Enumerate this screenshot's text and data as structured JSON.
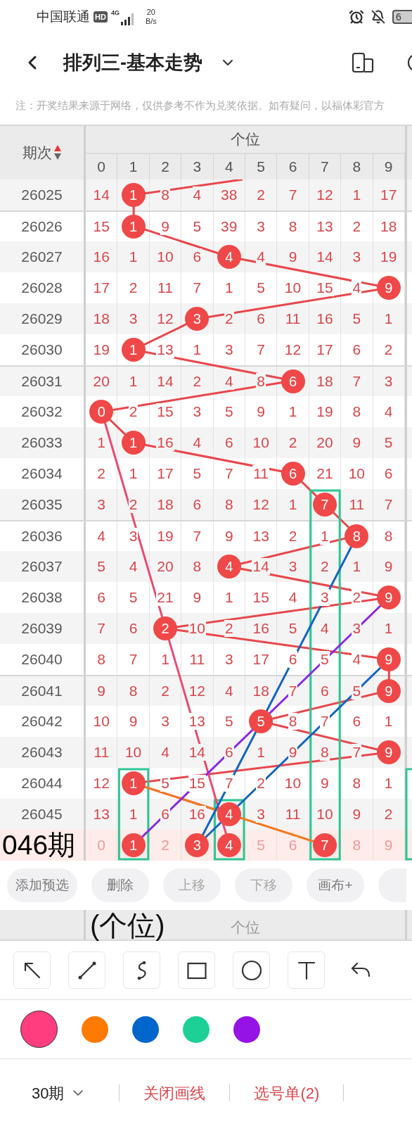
{
  "status_bar": {
    "carrier": "中国联通",
    "hd": "HD",
    "network": "4G",
    "speed_value": "20",
    "speed_unit": "B/s",
    "battery": "6"
  },
  "title_bar": {
    "title": "排列三-基本走势"
  },
  "notice": "注：开奖结果来源于网络，仅供参考不作为兑奖依据。如有疑问，以福体彩官方",
  "table": {
    "period_header": "期次",
    "group_header": "个位",
    "columns": [
      "0",
      "1",
      "2",
      "3",
      "4",
      "5",
      "6",
      "7",
      "8",
      "9"
    ],
    "rows": [
      {
        "period": "26025",
        "kind": "draw",
        "cells": [
          {
            "text": "14",
            "hit": false
          },
          {
            "text": "1",
            "hit": true
          },
          {
            "text": "8",
            "hit": false
          },
          {
            "text": "4",
            "hit": false
          },
          {
            "text": "38",
            "hit": false
          },
          {
            "text": "2",
            "hit": false
          },
          {
            "text": "7",
            "hit": false
          },
          {
            "text": "12",
            "hit": false
          },
          {
            "text": "1",
            "hit": false
          },
          {
            "text": "17",
            "hit": false
          }
        ]
      },
      {
        "period": "26026",
        "kind": "draw",
        "cells": [
          {
            "text": "15",
            "hit": false
          },
          {
            "text": "1",
            "hit": true
          },
          {
            "text": "9",
            "hit": false
          },
          {
            "text": "5",
            "hit": false
          },
          {
            "text": "39",
            "hit": false
          },
          {
            "text": "3",
            "hit": false
          },
          {
            "text": "8",
            "hit": false
          },
          {
            "text": "13",
            "hit": false
          },
          {
            "text": "2",
            "hit": false
          },
          {
            "text": "18",
            "hit": false
          }
        ]
      },
      {
        "period": "26027",
        "kind": "draw",
        "cells": [
          {
            "text": "16",
            "hit": false
          },
          {
            "text": "1",
            "hit": false
          },
          {
            "text": "10",
            "hit": false
          },
          {
            "text": "6",
            "hit": false
          },
          {
            "text": "4",
            "hit": true
          },
          {
            "text": "4",
            "hit": false
          },
          {
            "text": "9",
            "hit": false
          },
          {
            "text": "14",
            "hit": false
          },
          {
            "text": "3",
            "hit": false
          },
          {
            "text": "19",
            "hit": false
          }
        ]
      },
      {
        "period": "26028",
        "kind": "draw",
        "cells": [
          {
            "text": "17",
            "hit": false
          },
          {
            "text": "2",
            "hit": false
          },
          {
            "text": "11",
            "hit": false
          },
          {
            "text": "7",
            "hit": false
          },
          {
            "text": "1",
            "hit": false
          },
          {
            "text": "5",
            "hit": false
          },
          {
            "text": "10",
            "hit": false
          },
          {
            "text": "15",
            "hit": false
          },
          {
            "text": "4",
            "hit": false
          },
          {
            "text": "9",
            "hit": true
          }
        ]
      },
      {
        "period": "26029",
        "kind": "draw",
        "cells": [
          {
            "text": "18",
            "hit": false
          },
          {
            "text": "3",
            "hit": false
          },
          {
            "text": "12",
            "hit": false
          },
          {
            "text": "3",
            "hit": true
          },
          {
            "text": "2",
            "hit": false
          },
          {
            "text": "6",
            "hit": false
          },
          {
            "text": "11",
            "hit": false
          },
          {
            "text": "16",
            "hit": false
          },
          {
            "text": "5",
            "hit": false
          },
          {
            "text": "1",
            "hit": false
          }
        ]
      },
      {
        "period": "26030",
        "kind": "draw",
        "cells": [
          {
            "text": "19",
            "hit": false
          },
          {
            "text": "1",
            "hit": true
          },
          {
            "text": "13",
            "hit": false
          },
          {
            "text": "1",
            "hit": false
          },
          {
            "text": "3",
            "hit": false
          },
          {
            "text": "7",
            "hit": false
          },
          {
            "text": "12",
            "hit": false
          },
          {
            "text": "17",
            "hit": false
          },
          {
            "text": "6",
            "hit": false
          },
          {
            "text": "2",
            "hit": false
          }
        ]
      },
      {
        "period": "26031",
        "kind": "draw",
        "cells": [
          {
            "text": "20",
            "hit": false
          },
          {
            "text": "1",
            "hit": false
          },
          {
            "text": "14",
            "hit": false
          },
          {
            "text": "2",
            "hit": false
          },
          {
            "text": "4",
            "hit": false
          },
          {
            "text": "8",
            "hit": false
          },
          {
            "text": "6",
            "hit": true
          },
          {
            "text": "18",
            "hit": false
          },
          {
            "text": "7",
            "hit": false
          },
          {
            "text": "3",
            "hit": false
          }
        ]
      },
      {
        "period": "26032",
        "kind": "draw",
        "cells": [
          {
            "text": "0",
            "hit": true
          },
          {
            "text": "2",
            "hit": false
          },
          {
            "text": "15",
            "hit": false
          },
          {
            "text": "3",
            "hit": false
          },
          {
            "text": "5",
            "hit": false
          },
          {
            "text": "9",
            "hit": false
          },
          {
            "text": "1",
            "hit": false
          },
          {
            "text": "19",
            "hit": false
          },
          {
            "text": "8",
            "hit": false
          },
          {
            "text": "4",
            "hit": false
          }
        ]
      },
      {
        "period": "26033",
        "kind": "draw",
        "cells": [
          {
            "text": "1",
            "hit": false
          },
          {
            "text": "1",
            "hit": true
          },
          {
            "text": "16",
            "hit": false
          },
          {
            "text": "4",
            "hit": false
          },
          {
            "text": "6",
            "hit": false
          },
          {
            "text": "10",
            "hit": false
          },
          {
            "text": "2",
            "hit": false
          },
          {
            "text": "20",
            "hit": false
          },
          {
            "text": "9",
            "hit": false
          },
          {
            "text": "5",
            "hit": false
          }
        ]
      },
      {
        "period": "26034",
        "kind": "draw",
        "cells": [
          {
            "text": "2",
            "hit": false
          },
          {
            "text": "1",
            "hit": false
          },
          {
            "text": "17",
            "hit": false
          },
          {
            "text": "5",
            "hit": false
          },
          {
            "text": "7",
            "hit": false
          },
          {
            "text": "11",
            "hit": false
          },
          {
            "text": "6",
            "hit": true
          },
          {
            "text": "21",
            "hit": false
          },
          {
            "text": "10",
            "hit": false
          },
          {
            "text": "6",
            "hit": false
          }
        ]
      },
      {
        "period": "26035",
        "kind": "draw",
        "cells": [
          {
            "text": "3",
            "hit": false
          },
          {
            "text": "2",
            "hit": false
          },
          {
            "text": "18",
            "hit": false
          },
          {
            "text": "6",
            "hit": false
          },
          {
            "text": "8",
            "hit": false
          },
          {
            "text": "12",
            "hit": false
          },
          {
            "text": "1",
            "hit": false
          },
          {
            "text": "7",
            "hit": true
          },
          {
            "text": "11",
            "hit": false
          },
          {
            "text": "7",
            "hit": false
          }
        ]
      },
      {
        "period": "26036",
        "kind": "draw",
        "cells": [
          {
            "text": "4",
            "hit": false
          },
          {
            "text": "3",
            "hit": false
          },
          {
            "text": "19",
            "hit": false
          },
          {
            "text": "7",
            "hit": false
          },
          {
            "text": "9",
            "hit": false
          },
          {
            "text": "13",
            "hit": false
          },
          {
            "text": "2",
            "hit": false
          },
          {
            "text": "1",
            "hit": false
          },
          {
            "text": "8",
            "hit": true
          },
          {
            "text": "8",
            "hit": false
          }
        ]
      },
      {
        "period": "26037",
        "kind": "draw",
        "cells": [
          {
            "text": "5",
            "hit": false
          },
          {
            "text": "4",
            "hit": false
          },
          {
            "text": "20",
            "hit": false
          },
          {
            "text": "8",
            "hit": false
          },
          {
            "text": "4",
            "hit": true
          },
          {
            "text": "14",
            "hit": false
          },
          {
            "text": "3",
            "hit": false
          },
          {
            "text": "2",
            "hit": false
          },
          {
            "text": "1",
            "hit": false
          },
          {
            "text": "9",
            "hit": false
          }
        ]
      },
      {
        "period": "26038",
        "kind": "draw",
        "cells": [
          {
            "text": "6",
            "hit": false
          },
          {
            "text": "5",
            "hit": false
          },
          {
            "text": "21",
            "hit": false
          },
          {
            "text": "9",
            "hit": false
          },
          {
            "text": "1",
            "hit": false
          },
          {
            "text": "15",
            "hit": false
          },
          {
            "text": "4",
            "hit": false
          },
          {
            "text": "3",
            "hit": false
          },
          {
            "text": "2",
            "hit": false
          },
          {
            "text": "9",
            "hit": true
          }
        ]
      },
      {
        "period": "26039",
        "kind": "draw",
        "cells": [
          {
            "text": "7",
            "hit": false
          },
          {
            "text": "6",
            "hit": false
          },
          {
            "text": "2",
            "hit": true
          },
          {
            "text": "10",
            "hit": false
          },
          {
            "text": "2",
            "hit": false
          },
          {
            "text": "16",
            "hit": false
          },
          {
            "text": "5",
            "hit": false
          },
          {
            "text": "4",
            "hit": false
          },
          {
            "text": "3",
            "hit": false
          },
          {
            "text": "1",
            "hit": false
          }
        ]
      },
      {
        "period": "26040",
        "kind": "draw",
        "cells": [
          {
            "text": "8",
            "hit": false
          },
          {
            "text": "7",
            "hit": false
          },
          {
            "text": "1",
            "hit": false
          },
          {
            "text": "11",
            "hit": false
          },
          {
            "text": "3",
            "hit": false
          },
          {
            "text": "17",
            "hit": false
          },
          {
            "text": "6",
            "hit": false
          },
          {
            "text": "5",
            "hit": false
          },
          {
            "text": "4",
            "hit": false
          },
          {
            "text": "9",
            "hit": true
          }
        ]
      },
      {
        "period": "26041",
        "kind": "draw",
        "cells": [
          {
            "text": "9",
            "hit": false
          },
          {
            "text": "8",
            "hit": false
          },
          {
            "text": "2",
            "hit": false
          },
          {
            "text": "12",
            "hit": false
          },
          {
            "text": "4",
            "hit": false
          },
          {
            "text": "18",
            "hit": false
          },
          {
            "text": "7",
            "hit": false
          },
          {
            "text": "6",
            "hit": false
          },
          {
            "text": "5",
            "hit": false
          },
          {
            "text": "9",
            "hit": true
          }
        ]
      },
      {
        "period": "26042",
        "kind": "draw",
        "cells": [
          {
            "text": "10",
            "hit": false
          },
          {
            "text": "9",
            "hit": false
          },
          {
            "text": "3",
            "hit": false
          },
          {
            "text": "13",
            "hit": false
          },
          {
            "text": "5",
            "hit": false
          },
          {
            "text": "5",
            "hit": true
          },
          {
            "text": "8",
            "hit": false
          },
          {
            "text": "7",
            "hit": false
          },
          {
            "text": "6",
            "hit": false
          },
          {
            "text": "1",
            "hit": false
          }
        ]
      },
      {
        "period": "26043",
        "kind": "draw",
        "cells": [
          {
            "text": "11",
            "hit": false
          },
          {
            "text": "10",
            "hit": false
          },
          {
            "text": "4",
            "hit": false
          },
          {
            "text": "14",
            "hit": false
          },
          {
            "text": "6",
            "hit": false
          },
          {
            "text": "1",
            "hit": false
          },
          {
            "text": "9",
            "hit": false
          },
          {
            "text": "8",
            "hit": false
          },
          {
            "text": "7",
            "hit": false
          },
          {
            "text": "9",
            "hit": true
          }
        ]
      },
      {
        "period": "26044",
        "kind": "draw",
        "cells": [
          {
            "text": "12",
            "hit": false
          },
          {
            "text": "1",
            "hit": true
          },
          {
            "text": "5",
            "hit": false
          },
          {
            "text": "15",
            "hit": false
          },
          {
            "text": "7",
            "hit": false
          },
          {
            "text": "2",
            "hit": false
          },
          {
            "text": "10",
            "hit": false
          },
          {
            "text": "9",
            "hit": false
          },
          {
            "text": "8",
            "hit": false
          },
          {
            "text": "1",
            "hit": false
          }
        ]
      },
      {
        "period": "26045",
        "kind": "draw",
        "cells": [
          {
            "text": "13",
            "hit": false
          },
          {
            "text": "1",
            "hit": false
          },
          {
            "text": "6",
            "hit": false
          },
          {
            "text": "16",
            "hit": false
          },
          {
            "text": "4",
            "hit": true
          },
          {
            "text": "3",
            "hit": false
          },
          {
            "text": "11",
            "hit": false
          },
          {
            "text": "10",
            "hit": false
          },
          {
            "text": "9",
            "hit": false
          },
          {
            "text": "2",
            "hit": false
          }
        ]
      },
      {
        "period": "046期",
        "kind": "pick",
        "cells": [
          {
            "text": "0",
            "hit": false
          },
          {
            "text": "1",
            "hit": true
          },
          {
            "text": "2",
            "hit": false
          },
          {
            "text": "3",
            "hit": true
          },
          {
            "text": "4",
            "hit": true
          },
          {
            "text": "5",
            "hit": false
          },
          {
            "text": "6",
            "hit": false
          },
          {
            "text": "7",
            "hit": true
          },
          {
            "text": "8",
            "hit": false
          },
          {
            "text": "9",
            "hit": false
          }
        ]
      }
    ]
  },
  "actions": [
    {
      "label": "添加预选",
      "disabled": false
    },
    {
      "label": "删除",
      "disabled": false
    },
    {
      "label": "上移",
      "disabled": true
    },
    {
      "label": "下移",
      "disabled": true
    },
    {
      "label": "画布+",
      "disabled": false
    }
  ],
  "canvas_label": "(个位)",
  "footer_header": "个位",
  "draw_tools": [
    {
      "kind": "arrow"
    },
    {
      "kind": "line"
    },
    {
      "kind": "curve"
    },
    {
      "kind": "rect"
    },
    {
      "kind": "circle"
    },
    {
      "kind": "text"
    },
    {
      "kind": "undo"
    }
  ],
  "colors": [
    {
      "color": "#ff3d7f",
      "selected": true
    },
    {
      "color": "#ff7a00",
      "selected": false
    },
    {
      "color": "#0066cc",
      "selected": false
    },
    {
      "color": "#1dd196",
      "selected": false
    },
    {
      "color": "#9513e6",
      "selected": false
    }
  ],
  "bottom_bar": {
    "periods": "30期",
    "links": [
      "关闭画线",
      "选号单(2)"
    ]
  }
}
